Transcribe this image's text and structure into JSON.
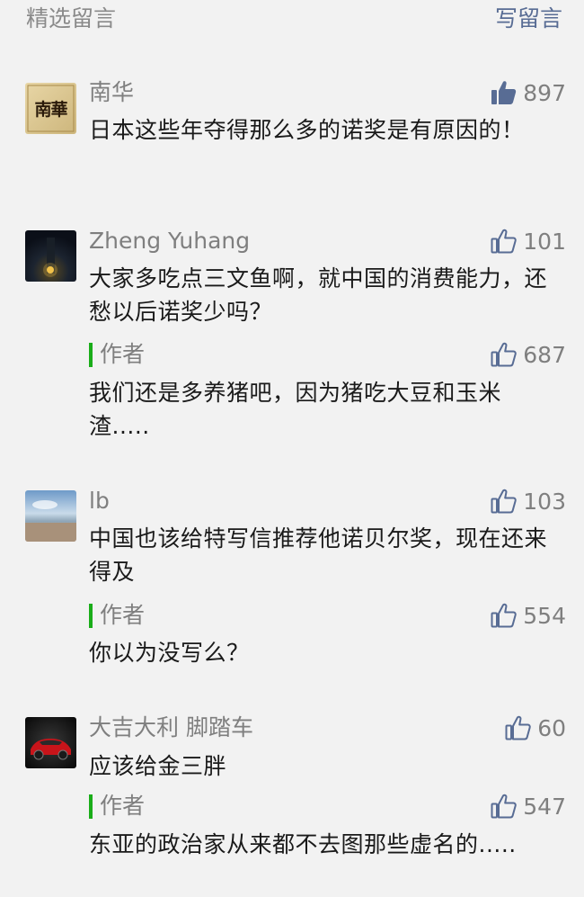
{
  "header": {
    "title": "精选留言",
    "action": "写留言"
  },
  "comments": [
    {
      "nickname": "南华",
      "likes": "897",
      "liked": true,
      "text": "日本这些年夺得那么多的诺奖是有原因的！",
      "avatar_text": "南華"
    },
    {
      "nickname": "Zheng Yuhang",
      "likes": "101",
      "liked": false,
      "text": "大家多吃点三文鱼啊，就中国的消费能力，还愁以后诺奖少吗？",
      "reply": {
        "label": "作者",
        "likes": "687",
        "text": "我们还是多养猪吧，因为猪吃大豆和玉米渣....."
      }
    },
    {
      "nickname": "lb",
      "likes": "103",
      "liked": false,
      "text": "中国也该给特写信推荐他诺贝尔奖，现在还来得及",
      "reply": {
        "label": "作者",
        "likes": "554",
        "text": "你以为没写么？"
      }
    },
    {
      "nickname": "大吉大利 脚踏车",
      "likes": "60",
      "liked": false,
      "text": "应该给金三胖",
      "reply": {
        "label": "作者",
        "likes": "547",
        "text": "东亚的政治家从来都不去图那些虚名的....."
      }
    }
  ]
}
